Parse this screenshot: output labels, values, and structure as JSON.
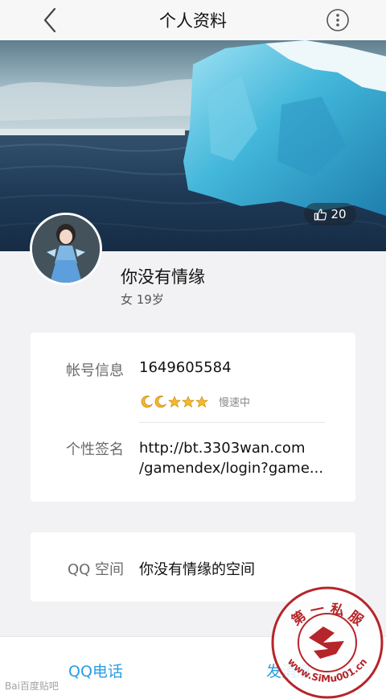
{
  "nav": {
    "title": "个人资料",
    "back_icon": "chevron-left-icon",
    "more_icon": "more-dots-icon"
  },
  "cover": {
    "like_icon": "thumb-up-icon",
    "like_count": "20"
  },
  "profile": {
    "name": "你没有情缘",
    "meta": "女 19岁"
  },
  "account": {
    "label": "帐号信息",
    "value": "1649605584",
    "level_icons": [
      "moon",
      "moon",
      "star",
      "star",
      "star"
    ],
    "level_status": "慢速中"
  },
  "signature": {
    "label": "个性签名",
    "line1": "http://bt.3303wan.com",
    "line2": "/gamendex/login?game..."
  },
  "space": {
    "label": "QQ 空间",
    "value": "你没有情缘的空间"
  },
  "bottom": {
    "call_label": "QQ电话",
    "message_label": "发消息"
  },
  "watermarks": {
    "baidu": "Bai百度贴吧",
    "seal_top": "第 一 私 服",
    "seal_bottom": "www.SiMu001.cn"
  },
  "colors": {
    "accent": "#2a9ee3",
    "star": "#f5b82e",
    "seal": "#b5252a"
  }
}
